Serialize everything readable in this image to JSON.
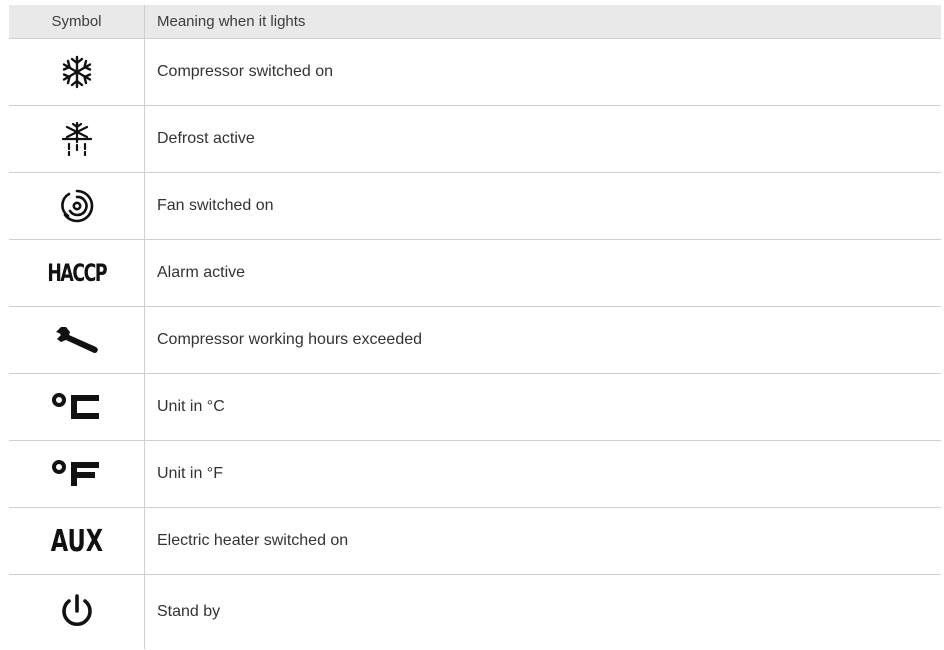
{
  "table": {
    "header": {
      "symbol": "Symbol",
      "meaning": "Meaning when it lights"
    },
    "rows": [
      {
        "icon": "snowflake-icon",
        "meaning": "Compressor switched on"
      },
      {
        "icon": "defrost-icon",
        "meaning": "Defrost active"
      },
      {
        "icon": "fan-icon",
        "meaning": "Fan switched on"
      },
      {
        "icon": "haccp-icon",
        "symbol_text": "HACCP",
        "meaning": "Alarm active"
      },
      {
        "icon": "wrench-icon",
        "meaning": "Compressor working hours exceeded"
      },
      {
        "icon": "celsius-icon",
        "meaning": "Unit in °C"
      },
      {
        "icon": "fahrenheit-icon",
        "meaning": "Unit in °F"
      },
      {
        "icon": "aux-icon",
        "symbol_text": "AUX",
        "meaning": "Electric heater switched on"
      },
      {
        "icon": "power-icon",
        "meaning": "Stand by"
      }
    ]
  }
}
